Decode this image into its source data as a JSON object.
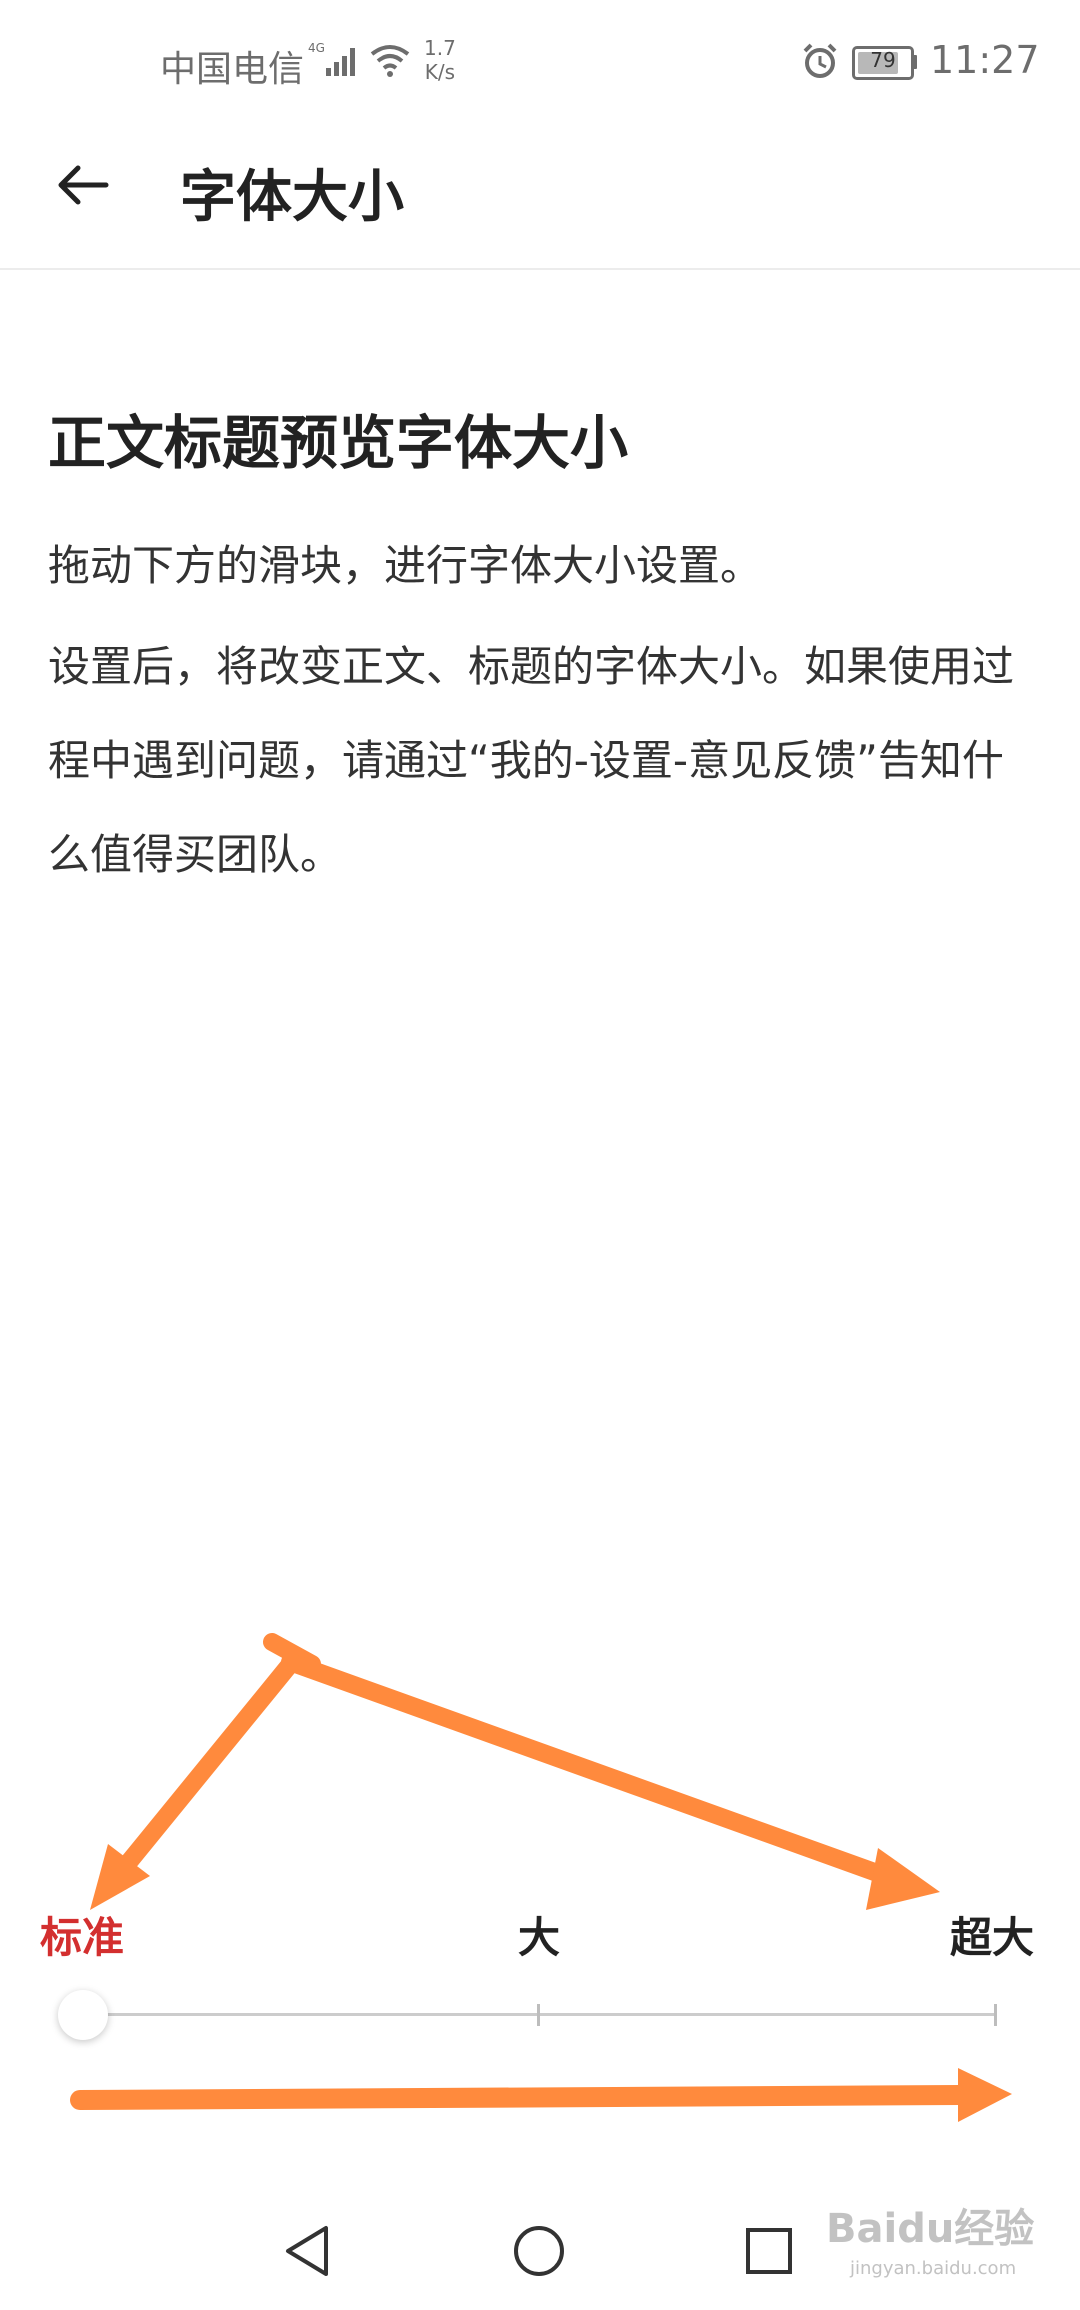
{
  "status_bar": {
    "carrier": "中国电信",
    "network": "4G",
    "speed_value": "1.7",
    "speed_unit": "K/s",
    "battery": "79",
    "battery_level": 0.79,
    "time": "11:27"
  },
  "header": {
    "back_icon": "back-arrow-icon",
    "title": "字体大小"
  },
  "preview": {
    "title": "正文标题预览字体大小",
    "paragraph1": "拖动下方的滑块，进行字体大小设置。",
    "paragraph2": "设置后，将改变正文、标题的字体大小。如果使用过程中遇到问题，请通过“我的-设置-意见反馈”告知什么值得买团队。"
  },
  "slider": {
    "labels": [
      "标准",
      "大",
      "超大"
    ],
    "selected_index": 0,
    "active_color": "#d32f2f"
  },
  "annotations": {
    "arrow_color": "#ff8a3d"
  },
  "nav_bar": {
    "back": "triangle-back-icon",
    "home": "circle-home-icon",
    "recents": "square-recents-icon"
  },
  "watermark": {
    "text": "Baidu经验",
    "subtext": "jingyan.baidu.com"
  }
}
